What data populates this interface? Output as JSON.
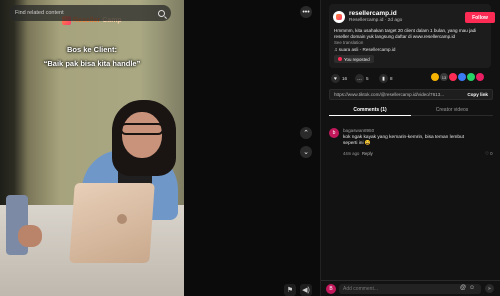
{
  "video": {
    "search_placeholder": "Find related content",
    "logo_text_a": "Reseller",
    "logo_text_b": "Camp",
    "caption_line1": "Bos ke Client:",
    "caption_line2": "“Baik pak bisa kita handle”",
    "more_label": "•••",
    "up_label": "⌃",
    "down_label": "⌄"
  },
  "post": {
    "close_label": "✕",
    "username": "resellercamp.id",
    "meta": "Resellercamp.id · 2d ago",
    "follow_label": "Follow",
    "description": "Hmmmm, kita usahakan target 20 client dalam 1 bulan, yang mau jadi reseller domain yuk langsung daftar di www.resellercamp.id",
    "see_translation": "See translation",
    "music": "♫  suara asli - Resellercamp.id",
    "reposted": "You reposted"
  },
  "actions": {
    "likes": "16",
    "comments": "5",
    "saves": "8",
    "shares_count": "13"
  },
  "link": {
    "url": "https://www.tiktok.com/@resellercamp.id/video/7613...",
    "copy_label": "Copy link"
  },
  "tabs": {
    "comments": "Comments (1)",
    "creator": "Creator videos"
  },
  "comments": [
    {
      "avatar_initial": "b",
      "user": "bagaswan8950",
      "text": "kok ngak kayak yang kemarin-kemrin, bisa teman lembut seperti ini 😄",
      "time": "44m ago",
      "reply": "Reply",
      "likes": "0"
    }
  ],
  "comment_bar": {
    "avatar_initial": "B",
    "placeholder": "Add comment...",
    "at": "@",
    "emoji": "☺",
    "send": "➤"
  },
  "colors": {
    "accent": "#fe2c55",
    "brand_orange": "#ff7a2e"
  }
}
